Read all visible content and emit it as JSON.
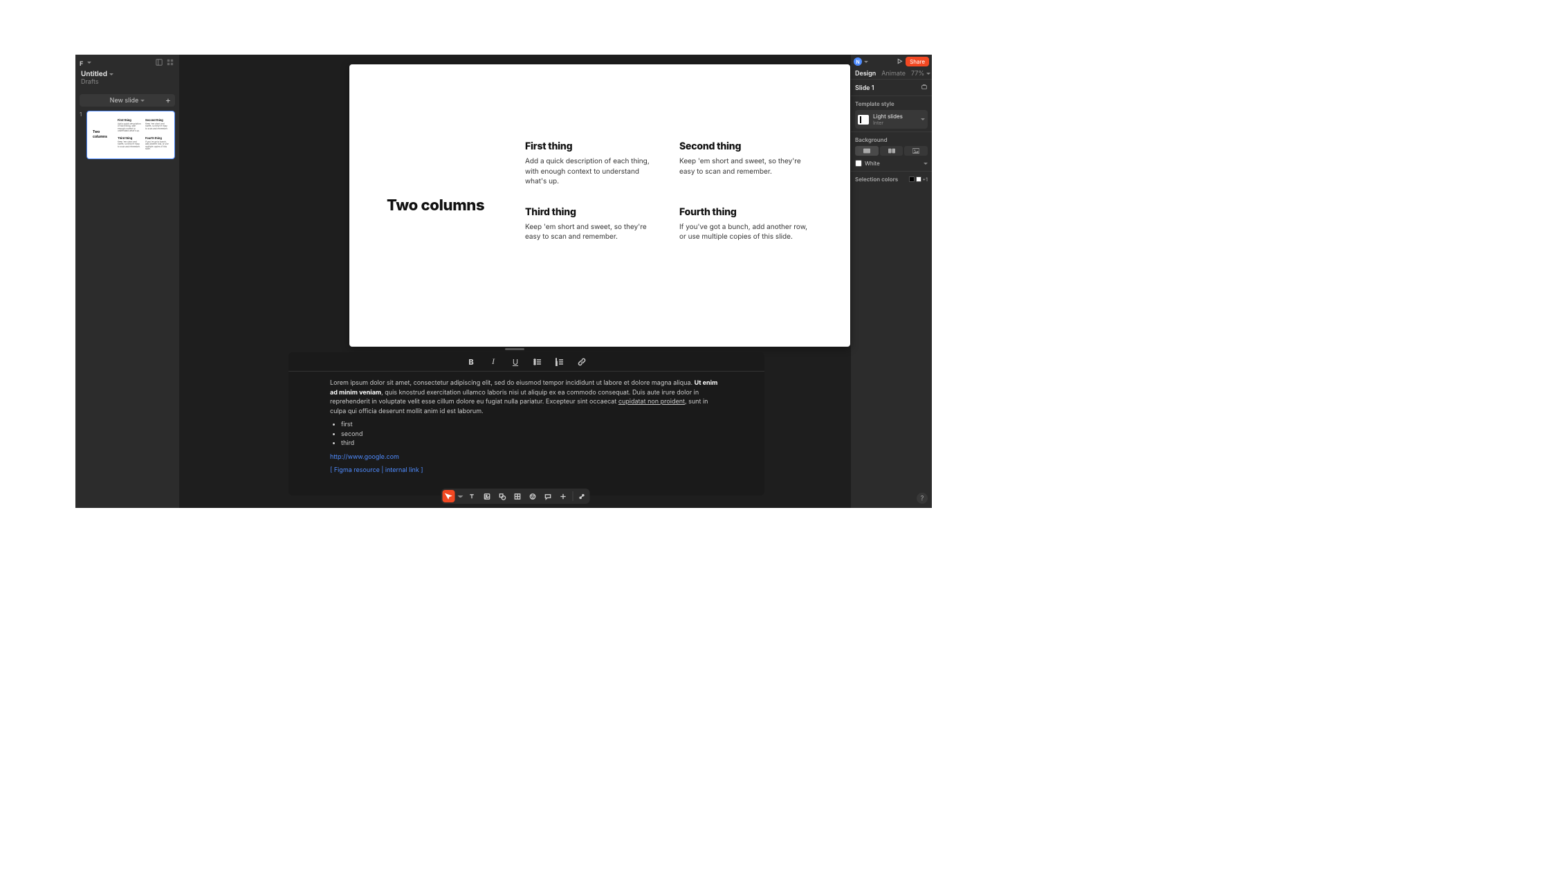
{
  "left": {
    "file_title": "Untitled",
    "location": "Drafts",
    "new_slide_label": "New slide",
    "thumb_num": "1"
  },
  "slide": {
    "title": "Two columns",
    "cells": [
      {
        "h": "First thing",
        "b": "Add a quick description of each thing, with enough context to understand what's up."
      },
      {
        "h": "Second thing",
        "b": "Keep 'em short and sweet, so they're easy to scan and remember."
      },
      {
        "h": "Third thing",
        "b": "Keep 'em short and sweet, so they're easy to scan and remember."
      },
      {
        "h": "Fourth thing",
        "b": "If you've got a bunch, add another row, or use multiple copies of this slide."
      }
    ]
  },
  "right": {
    "avatar_initial": "N",
    "share_label": "Share",
    "tab_design": "Design",
    "tab_animate": "Animate",
    "zoom": "77%",
    "slide_label": "Slide 1",
    "template_heading": "Template style",
    "template_name": "Light slides",
    "template_font": "Inter",
    "background_heading": "Background",
    "bg_color_name": "White",
    "selection_heading": "Selection colors",
    "plus_one": "+1"
  },
  "notes": {
    "p1_a": "Lorem ipsum dolor sit amet, consectetur adipiscing elit, sed do eiusmod  tempor incididunt ut labore et dolore magna aliqua. ",
    "p1_bold": "Ut enim ad minim  veniam",
    "p1_b": ", quis knostrud exercitation ullamco laboris nisi ut aliquip ex ea  commodo consequat. Duis aute irure dolor in reprehenderit in voluptate  velit esse cillum dolore eu fugiat nulla pariatur. Excepteur sint  occaecat ",
    "p1_under": "cupidatat non proident",
    "p1_c": ", sunt in culpa qui officia deserunt  mollit anim id est laborum.",
    "bullets": [
      "first",
      "second",
      "third"
    ],
    "link_url": "http://www.google.com",
    "internal_link": "[ Figma resource | internal link ]"
  },
  "help": "?"
}
